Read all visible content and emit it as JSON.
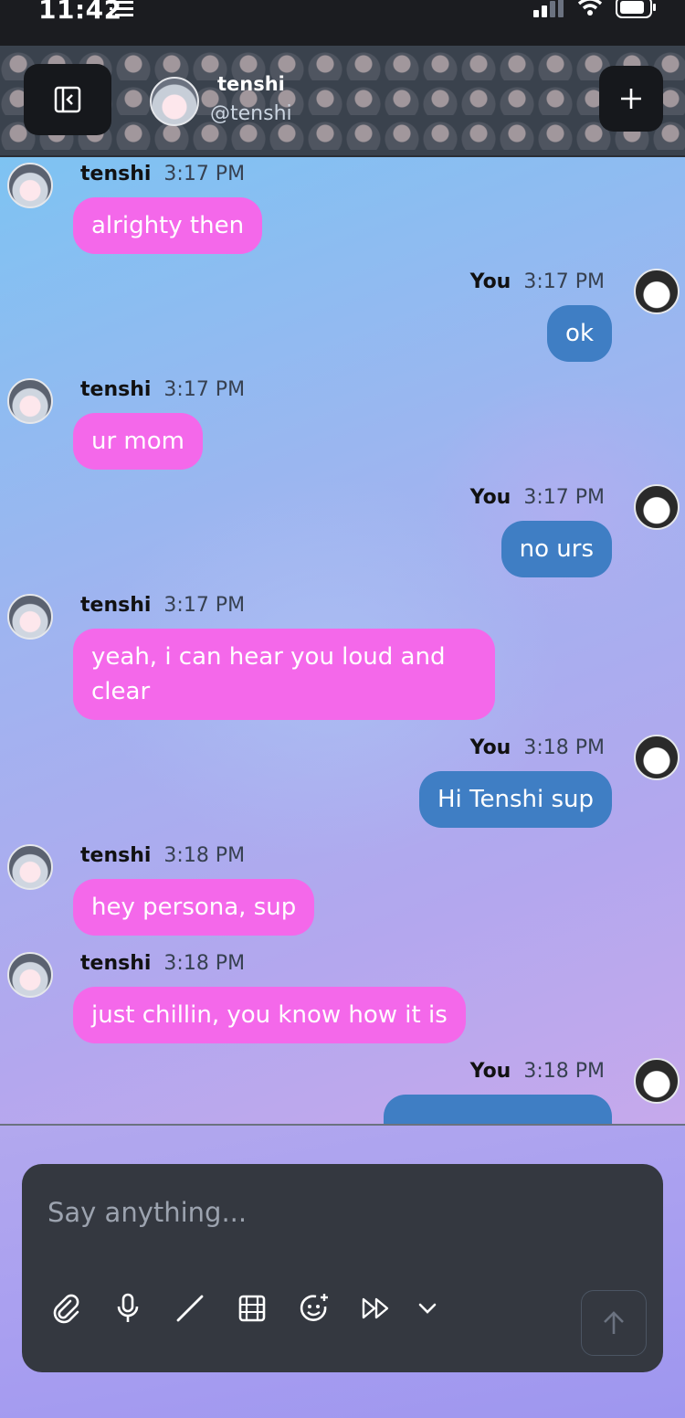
{
  "status_bar": {
    "time": "11:42"
  },
  "header": {
    "name": "tenshi",
    "handle": "@tenshi",
    "back_icon": "sidebar-collapse-icon",
    "add_icon": "plus-icon"
  },
  "messages": [
    {
      "sender": "tenshi",
      "time": "3:17 PM",
      "text": "alrighty then"
    },
    {
      "sender": "You",
      "time": "3:17 PM",
      "text": "ok"
    },
    {
      "sender": "tenshi",
      "time": "3:17 PM",
      "text": "ur mom"
    },
    {
      "sender": "You",
      "time": "3:17 PM",
      "text": "no urs"
    },
    {
      "sender": "tenshi",
      "time": "3:17 PM",
      "text": "yeah, i can hear you loud and clear"
    },
    {
      "sender": "You",
      "time": "3:18 PM",
      "text": "Hi Tenshi sup"
    },
    {
      "sender": "tenshi",
      "time": "3:18 PM",
      "text": "hey persona, sup"
    },
    {
      "sender": "tenshi",
      "time": "3:18 PM",
      "text": "just chillin, you know how it is"
    },
    {
      "sender": "You",
      "time": "3:18 PM",
      "text": ""
    }
  ],
  "composer": {
    "placeholder": "Say anything...",
    "tools": [
      "paperclip-icon",
      "microphone-icon",
      "slash-icon",
      "film-icon",
      "emoji-plus-icon",
      "fast-forward-icon",
      "chevron-down-icon"
    ],
    "send_icon": "arrow-up-icon"
  },
  "colors": {
    "bot_bubble": "#f468ea",
    "user_bubble": "#3f7ec4",
    "composer_bg": "#343840"
  }
}
